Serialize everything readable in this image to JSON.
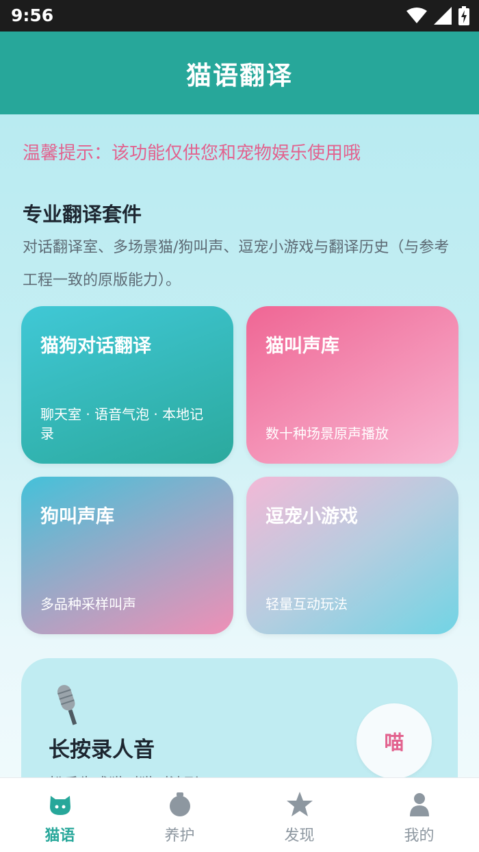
{
  "status_bar": {
    "time": "9:56"
  },
  "header": {
    "title": "猫语翻译"
  },
  "tip": "温馨提示：该功能仅供您和宠物娱乐使用哦",
  "section": {
    "title": "专业翻译套件",
    "description": "对话翻译室、多场景猫/狗叫声、逗宠小游戏与翻译历史（与参考工程一致的原版能力）。"
  },
  "cards": [
    {
      "title": "猫狗对话翻译",
      "subtitle": "聊天室 · 语音气泡 · 本地记录"
    },
    {
      "title": "猫叫声库",
      "subtitle": "数十种场景原声播放"
    },
    {
      "title": "狗叫声库",
      "subtitle": "多品种采样叫声"
    },
    {
      "title": "逗宠小游戏",
      "subtitle": "轻量互动玩法"
    }
  ],
  "record": {
    "icon": "microphone-icon",
    "title": "长按录人音",
    "subtitle": "松手生成猫叫猫叫波形",
    "button_label": "喵"
  },
  "nav": {
    "items": [
      {
        "label": "猫语",
        "icon": "cat-face-icon",
        "active": true
      },
      {
        "label": "养护",
        "icon": "food-bowl-icon",
        "active": false
      },
      {
        "label": "发现",
        "icon": "star-icon",
        "active": false
      },
      {
        "label": "我的",
        "icon": "person-icon",
        "active": false
      }
    ]
  },
  "colors": {
    "primary": "#27a79a",
    "accent_pink": "#e2628e",
    "status_bar": "#1c1c1c"
  }
}
